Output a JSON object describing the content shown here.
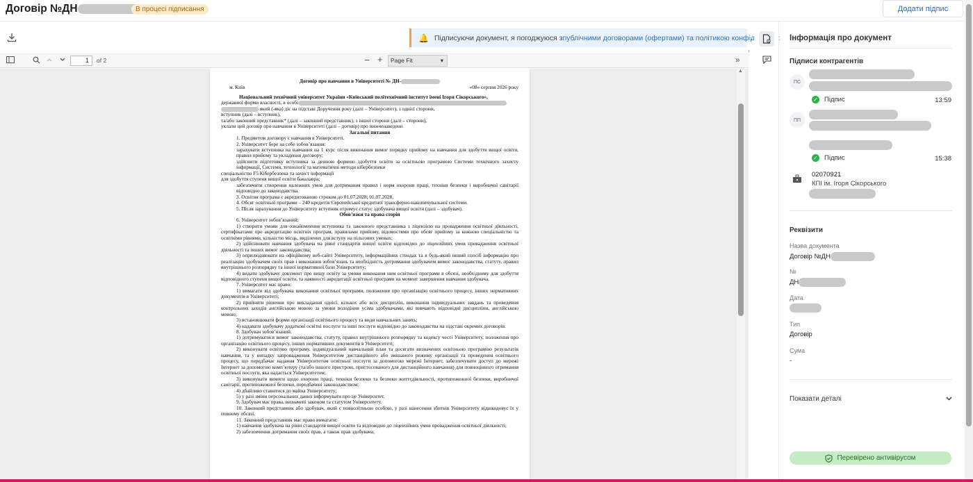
{
  "header": {
    "title": "Договір №ДН",
    "status": "В процесі підписання",
    "add_signature": "Додати підпис"
  },
  "notice": {
    "text_before": "Підписуючи документ, я погоджуюся з ",
    "link_text": "публічними договорами (офертами) та політикою конфіденційності"
  },
  "pdf_toolbar": {
    "page_value": "1",
    "page_total": "of 2",
    "zoom": "Page Fit"
  },
  "document": {
    "heading": "Договір про навчання в Університеті № ДН-",
    "city": "м. Київ",
    "date": "«08» серпня 2026 року",
    "lines": [
      "Національний технічний університет України «Київський політехнічний інститут імені Ігоря Сікорського»,",
      "державної форми власності, в особі",
      "             який (-яка) діє на підставі Доручення              року (далі – Університет), з однієї сторони,",
      "вступник                                           (далі – вступник),",
      "та/або законний представник*                    (далі – законний представник), з іншої сторони (далі – сторони),",
      "уклали цей договір про навчання в Університеті (далі – договір) про нижченаведене."
    ],
    "section1": "Загальні питання",
    "s1_lines": [
      "1. Предметом договору є навчання в Університеті.",
      "2. Університет бере на себе зобов’язання:",
      "зарахувати вступника на навчання на 1 курс після виконання вимог порядку прийому на навчання для здобуття вищої освіти, правил прийому та укладення договору;",
      "здійснити підготовку вступника за денною формою здобуття освіти за освітньою програмою Системи технічного захисту інформації, Системи, технології та математичні методи кібербезпеки",
      "спеціальністю F5 Кібербезпека та захист інформації",
      "для здобуття ступеня вищої освіти бакалавра;",
      "забезпечити створення належних умов для дотримання правил і норм охорони праці, техніки безпеки і виробничої санітарії відповідно до законодавства.",
      "3. Освітня програма є акредитованою строком до 01.07.2028; 01.07.2028.",
      "4. Обсяг освітньої програми – 240 кредитів Європейської кредитної трансферно-накопичувальної системи.",
      "5. Після зарахування до Університету вступник отримує статус здобувача вищої освіти (далі – здобувач)."
    ],
    "section2": "Обов’язки та права сторін",
    "s2_lines": [
      "6. Університет зобов’язаний:",
      "1) створити умови для ознайомлення вступника та законного представника з ліцензією на провадження освітньої діяльності, сертифікатами про акредитацію освітніх програм, правилами прийому, відомостями про обсяг прийому за кожною спеціальністю та освітніми рівнями, кількістю місць, виділених для вступу на пільгових умовах;",
      "2) здійснювати навчання здобувача на рівні стандартів вищої освіти відповідно до ліцензійних умов провадження освітньої діяльності та інших вимог законодавства;",
      "3) оприлюднювати на офіційному веб-сайті Університету, інформаційних стендах та в будь-який інший спосіб інформацію про реалізацію здобувачем своїх прав і виконання зобов’язань та необхідність дотримання здобувачем вимог законодавства, статуту, правил внутрішнього розпорядку та іншої нормативної бази Університету;",
      "4) видати здобувачу документ про вищу освіту за умови виконання ним освітньої програми в обсязі, необхідному для здобуття відповідного ступеня вищої освіти, та наявності акредитації освітньої програми на момент завершення навчання здобувача.",
      "7. Університет має право:",
      "1) вимагати від здобувача виконання освітньої програми, положення про організацію освітнього процесу, інших нормативних документів в Університеті;",
      "2) прийняти рішення про викладання однієї, кількох або всіх дисциплін, виконання індивідуальних завдань та проведення контрольних заходів англійською мовою за умови володіння усіма здобувачами, які вивчають відповідні дисципліни, англійською мовою;",
      "3) встановлювати форми організації освітнього процесу та види навчальних занять;",
      "4) надавати здобувачу додаткові освітні послуги та інші послуги відповідно до законодавства на підставі окремих договорів.",
      "8. Здобувач зобов’язаний:",
      "1) дотримуватися вимог законодавства, статуту, правил внутрішнього розпорядку та кодексу честі Університету, положення про організацію освітнього процесу, інших нормативних документів в Університеті;",
      "2) виконувати освітню програму, індивідуальний навчальний план та досягати визначених освітньою програмою результатів навчання, та у випадку запровадження Університетом дистанційного або змішаного режиму організації та проведення освітнього процесу, що передбачає надання Університетом освітньої послуги за допомогою мережі Інтернет, забезпечувати доступ до мережі Інтернет за допомогою комп’ютеру (та/або іншого пристрою, пристосованого для дистанційного навчання) для повноцінного отримання освітньої послуги, яка надається Університетом;",
      "3) виконувати вимоги щодо охорони праці, техніки безпеки та безпеки життєдіяльності, протипожежної безпеки, виробничої санітарії, протипожежної безпеки, передбачені законодавством;",
      "4) дбайливо ставитися до майна Університету;",
      "5) у разі зміни персональних даних інформувати про це Університет.",
      "9. Здобувач має права, визначені законом та статутом Університету.",
      "10. Законний представник або здобувач, який є повнолітньою особою, у разі нанесення збитків Університету відшкодовує їх у повному обсязі.",
      "11. Законний представник має право вимагати:",
      "1) навчання здобувача на рівні стандартів вищої освіти та відповідно до ліцензійних умов провадження освітньої діяльності;",
      "2) забезпечення дотримання своїх прав, а також прав здобувача;"
    ]
  },
  "right_panel": {
    "title": "Інформація про документ",
    "counterparties_heading": "Підписи контрагентів",
    "signers": [
      {
        "initials": "ПС",
        "status": "Підпис",
        "time": "13:59"
      },
      {
        "initials": "ПП",
        "status": "Підпис",
        "time": "15:38"
      }
    ],
    "org": {
      "code": "02070921",
      "name": "КПІ ім. Ігоря Сікорського"
    },
    "requisites_heading": "Реквізити",
    "fields": [
      {
        "label": "Назва документа",
        "value": "Договір №ДН"
      },
      {
        "label": "№",
        "value": "ДН"
      },
      {
        "label": "Дата",
        "value": ""
      },
      {
        "label": "Тип",
        "value": "Договір"
      },
      {
        "label": "Сума",
        "value": "-"
      }
    ],
    "show_details": "Показати деталі",
    "antivirus": "Перевірено антивірусом"
  },
  "colors": {
    "accent": "#2a6fbe",
    "status_bg": "#fdecc8",
    "ok": "#2db34a",
    "antivirus_bg": "#c5ecc2"
  }
}
